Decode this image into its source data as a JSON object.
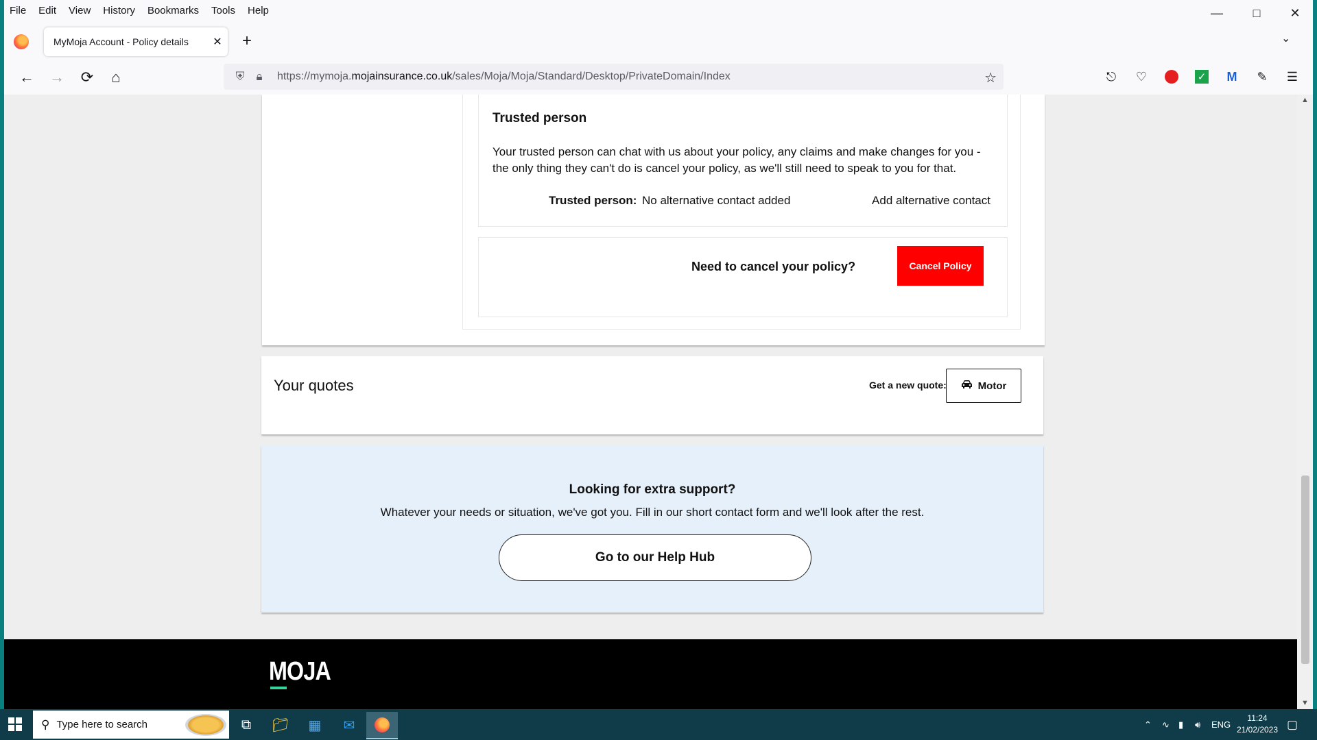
{
  "browser": {
    "menu": [
      "File",
      "Edit",
      "View",
      "History",
      "Bookmarks",
      "Tools",
      "Help"
    ],
    "tab_title": "MyMoja Account - Policy details",
    "url_prefix": "https://mymoja.",
    "url_domain": "mojainsurance.co.uk",
    "url_path": "/sales/Moja/Moja/Standard/Desktop/PrivateDomain/Index"
  },
  "trusted": {
    "heading": "Trusted person",
    "description": "Your trusted person can chat with us about your policy, any claims and make changes for you - the only thing they can't do is cancel your policy, as we'll still need to speak to you for that.",
    "label": "Trusted person:",
    "value": "No alternative contact added",
    "link": "Add alternative contact"
  },
  "cancel": {
    "question": "Need to cancel your policy?",
    "button": "Cancel Policy"
  },
  "quotes": {
    "title": "Your quotes",
    "get_new": "Get a new quote:",
    "motor": "Motor"
  },
  "support": {
    "title": "Looking for extra support?",
    "text": "Whatever your needs or situation, we've got you. Fill in our short contact form and we'll look after the rest.",
    "button": "Go to our Help Hub"
  },
  "footer": {
    "logo": "MOJA"
  },
  "taskbar": {
    "search_placeholder": "Type here to search",
    "lang": "ENG",
    "time": "11:24",
    "date": "21/02/2023"
  },
  "colors": {
    "cancel_red": "#ff0000",
    "support_bg": "#e6f0fa",
    "logo_accent": "#37d39a",
    "taskbar": "#0f3c48"
  }
}
